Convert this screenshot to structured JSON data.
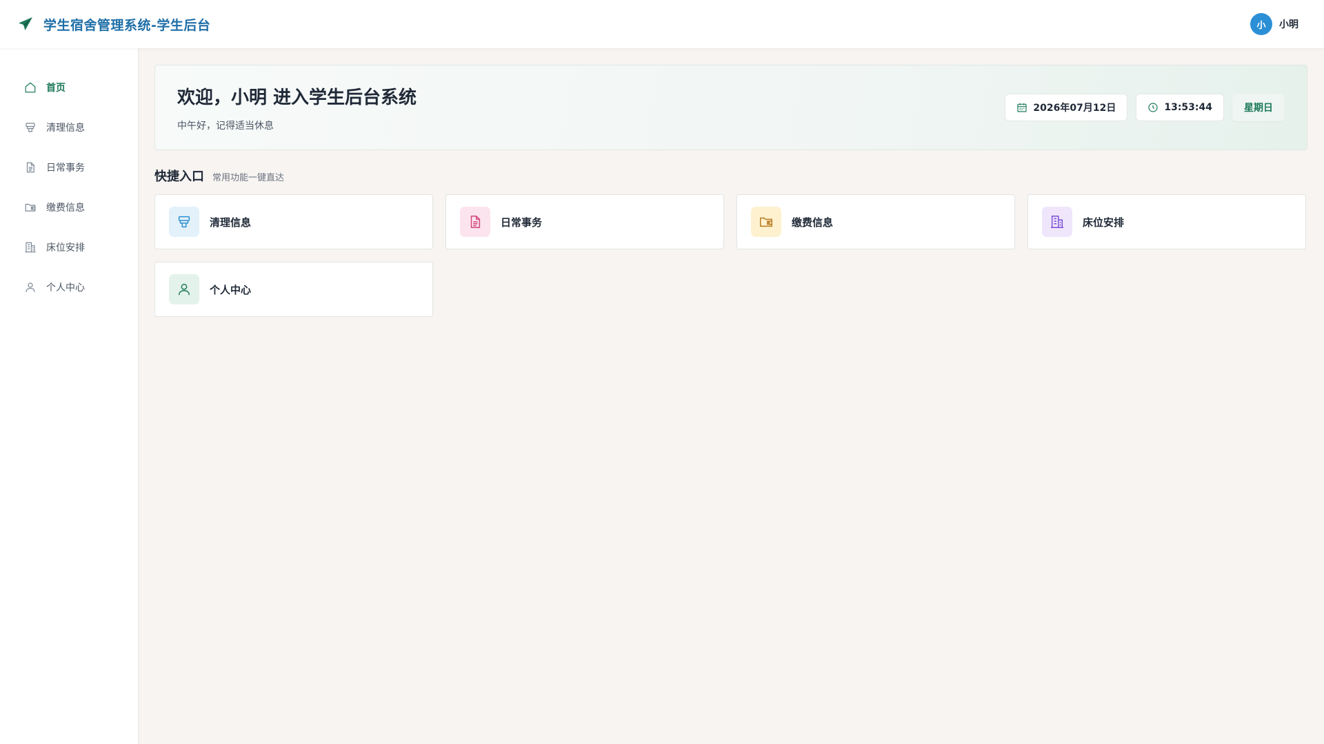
{
  "app": {
    "title": "学生宿舍管理系统-学生后台"
  },
  "user": {
    "avatar_text": "小",
    "name": "小明"
  },
  "sidebar": {
    "items": [
      {
        "label": "首页",
        "icon": "home-icon",
        "active": true
      },
      {
        "label": "清理信息",
        "icon": "cleaning-icon",
        "active": false
      },
      {
        "label": "日常事务",
        "icon": "document-icon",
        "active": false
      },
      {
        "label": "缴费信息",
        "icon": "wallet-icon",
        "active": false
      },
      {
        "label": "床位安排",
        "icon": "building-icon",
        "active": false
      },
      {
        "label": "个人中心",
        "icon": "user-icon",
        "active": false
      }
    ]
  },
  "welcome": {
    "title": "欢迎，小明 进入学生后台系统",
    "subtitle": "中午好，记得适当休息",
    "date": "2026年07月12日",
    "time": "13:53:44",
    "weekday": "星期日"
  },
  "quick": {
    "title": "快捷入口",
    "subtitle": "常用功能一键直达",
    "cards": [
      {
        "label": "清理信息",
        "icon": "cleaning-icon",
        "bg": "#e3f1fb",
        "color": "#2b8fd6"
      },
      {
        "label": "日常事务",
        "icon": "document-icon",
        "bg": "#fce4ee",
        "color": "#d2427a"
      },
      {
        "label": "缴费信息",
        "icon": "wallet-icon",
        "bg": "#fdf1cf",
        "color": "#b7791f"
      },
      {
        "label": "床位安排",
        "icon": "building-icon",
        "bg": "#efe6fb",
        "color": "#7c4dd6"
      },
      {
        "label": "个人中心",
        "icon": "user-icon",
        "bg": "#e4f2ec",
        "color": "#1e7a5a"
      }
    ]
  },
  "colors": {
    "brand": "#1f6fa8",
    "accent": "#1e7a5a",
    "avatar": "#2b8fd6"
  }
}
